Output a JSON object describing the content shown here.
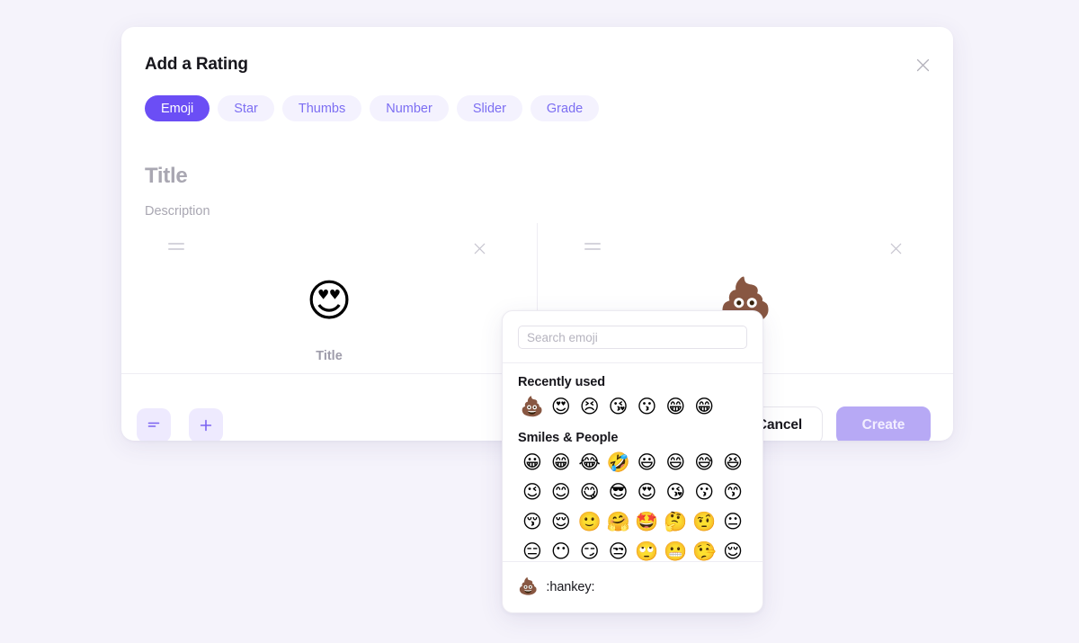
{
  "background_color": "#f5f3fb",
  "dialog": {
    "title": "Add a Rating",
    "close_icon": "close-icon",
    "accent_color": "#6b4ef5",
    "tabs": [
      {
        "label": "Emoji",
        "active": true
      },
      {
        "label": "Star",
        "active": false
      },
      {
        "label": "Thumbs",
        "active": false
      },
      {
        "label": "Number",
        "active": false
      },
      {
        "label": "Slider",
        "active": false
      },
      {
        "label": "Grade",
        "active": false
      }
    ],
    "rating_title_placeholder": "Title",
    "rating_description_placeholder": "Description",
    "options": [
      {
        "drag_handle_icon": "drag-handle-icon",
        "remove_icon": "close-icon",
        "emoji": "😍",
        "label_placeholder": "Title"
      },
      {
        "drag_handle_icon": "drag-handle-icon",
        "remove_icon": "close-icon",
        "emoji": "💩",
        "label_placeholder": ""
      }
    ],
    "footer": {
      "align_button_icon": "align-left-icon",
      "add_button_icon": "plus-icon",
      "cancel_label": "Cancel",
      "create_label": "Create",
      "create_disabled": true,
      "create_color": "#b7a9f5"
    }
  },
  "emoji_picker": {
    "search_placeholder": "Search emoji",
    "search_value": "",
    "recent_section_title": "Recently used",
    "recent_emojis": [
      "💩",
      "😍",
      "😣",
      "😘",
      "😗",
      "😁",
      "😁"
    ],
    "section_title": "Smiles & People",
    "emojis": [
      "😀",
      "😁",
      "😂",
      "🤣",
      "😃",
      "😄",
      "😅",
      "😆",
      "😉",
      "😊",
      "😋",
      "😎",
      "😍",
      "😘",
      "😗",
      "😙",
      "😚",
      "😌",
      "🙂",
      "🤗",
      "🤩",
      "🤔",
      "🤨",
      "😐",
      "😑",
      "😶",
      "😏",
      "😒",
      "🙄",
      "😬",
      "🤥",
      "😌"
    ],
    "preview": {
      "emoji": "💩",
      "shortcode": ":hankey:"
    }
  }
}
